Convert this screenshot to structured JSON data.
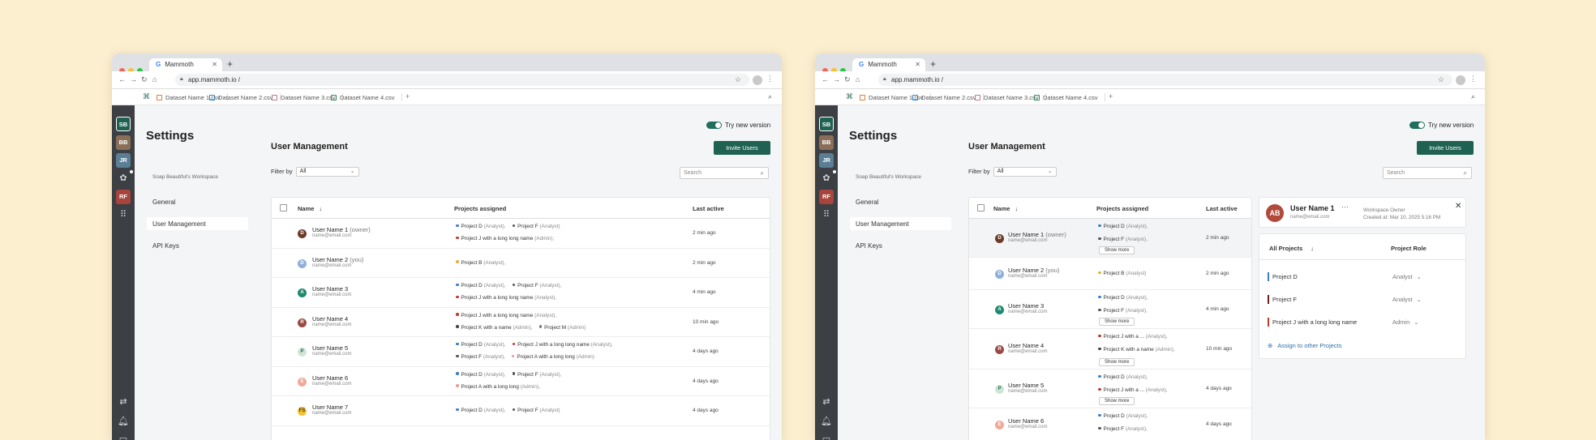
{
  "browser": {
    "tab_title": "Mammoth",
    "url": "app.mammoth.io /"
  },
  "file_tabs": [
    "Dataset Name 1.csv",
    "Dataset Name 2.csv",
    "Dataset Name 3.csv",
    "Dataset Name 4.csv"
  ],
  "file_tab_colors": [
    "#e07b39",
    "#2f80c8",
    "#c0787e",
    "#2e8b57"
  ],
  "rail_avatars": [
    {
      "initials": "SB",
      "color": "#1f6252"
    },
    {
      "initials": "BB",
      "color": "#8a6f58"
    },
    {
      "initials": "JR",
      "color": "#5a7f95"
    },
    {
      "initials": "RF",
      "color": "#a8443c"
    }
  ],
  "settings": {
    "title": "Settings",
    "workspace": "Soap Beautiful's Workspace",
    "nav": [
      "General",
      "User Management",
      "API Keys"
    ],
    "active_nav": "User Management"
  },
  "toggle_label": "Try new version",
  "user_management": {
    "title": "User Management",
    "invite_label": "Invite Users",
    "filter_label": "Filter by",
    "filter_value": "All",
    "search_placeholder": "Search",
    "columns": {
      "name": "Name",
      "projects": "Projects assigned",
      "last": "Last active"
    }
  },
  "users_full": [
    {
      "initial": "D",
      "color": "#6b3b2a",
      "name": "User Name 1",
      "suffix": "(owner)",
      "email": "name@email.com",
      "last": "2 min ago",
      "lines": [
        [
          {
            "p": "Project D",
            "r": "(Analyst),",
            "c": "#3d7cc9"
          },
          {
            "p": "Project F",
            "r": "(Analyst)",
            "c": "#555"
          }
        ],
        [
          {
            "p": "Project J with a long long name",
            "r": "(Admin),",
            "c": "#c0392b"
          }
        ]
      ]
    },
    {
      "initial": "D",
      "color": "#8fb0d8",
      "name": "User Name 2",
      "suffix": "(you)",
      "email": "name@email.com",
      "last": "2 min ago",
      "lines": [
        [
          {
            "p": "Project B",
            "r": "(Analyst),",
            "c": "#e3b431"
          }
        ]
      ]
    },
    {
      "initial": "A",
      "color": "#1e8a6e",
      "name": "User Name 3",
      "suffix": "",
      "email": "name@email.com",
      "last": "4 min ago",
      "lines": [
        [
          {
            "p": "Project D",
            "r": "(Analyst),",
            "c": "#3d7cc9"
          },
          {
            "p": "Project F",
            "r": "(Analyst),",
            "c": "#555"
          }
        ],
        [
          {
            "p": "Project J with a long long name",
            "r": "(Analyst),",
            "c": "#c0392b"
          }
        ]
      ]
    },
    {
      "initial": "R",
      "color": "#9a4a44",
      "name": "User Name 4",
      "suffix": "",
      "email": "name@email.com",
      "last": "10 min ago",
      "lines": [
        [
          {
            "p": "Project J with a long long name",
            "r": "(Analyst),",
            "c": "#c0392b"
          }
        ],
        [
          {
            "p": "Project K with a name",
            "r": "(Admin),",
            "c": "#444"
          },
          {
            "p": "Project M",
            "r": "(Admin)",
            "c": "#777"
          }
        ]
      ]
    },
    {
      "initial": "P",
      "color": "#cfe6d6",
      "name": "User Name 5",
      "suffix": "",
      "email": "name@email.com",
      "last": "4 days ago",
      "lines": [
        [
          {
            "p": "Project D",
            "r": "(Analyst),",
            "c": "#3d7cc9"
          },
          {
            "p": "Project J with a long long name",
            "r": "(Analyst),",
            "c": "#c0392b"
          }
        ],
        [
          {
            "p": "Project F",
            "r": "(Analyst),",
            "c": "#555"
          },
          {
            "p": "Project A with a long long",
            "r": "(Admin)",
            "c": "#e89a9a"
          }
        ]
      ]
    },
    {
      "initial": "E",
      "color": "#f0a898",
      "name": "User Name 6",
      "suffix": "",
      "email": "name@email.com",
      "last": "4 days ago",
      "lines": [
        [
          {
            "p": "Project D",
            "r": "(Analyst),",
            "c": "#3d7cc9"
          },
          {
            "p": "Project F",
            "r": "(Analyst),",
            "c": "#555"
          }
        ],
        [
          {
            "p": "Project A with a long long",
            "r": "(Admin),",
            "c": "#e89a9a"
          }
        ]
      ]
    },
    {
      "initial": "FS",
      "color": "#f2c230",
      "name": "User Name 7",
      "suffix": "",
      "email": "name@email.com",
      "last": "4 days ago",
      "lines": [
        [
          {
            "p": "Project D",
            "r": "(Analyst),",
            "c": "#3d7cc9"
          },
          {
            "p": "Project F",
            "r": "(Analyst)",
            "c": "#555"
          }
        ]
      ]
    }
  ],
  "users_compact": [
    {
      "initial": "D",
      "color": "#6b3b2a",
      "name": "User Name 1",
      "suffix": "(owner)",
      "email": "name@email.com",
      "last": "2 min ago",
      "lines": [
        {
          "p": "Project D",
          "r": "(Analyst),",
          "c": "#3d7cc9"
        },
        {
          "p": "Project F",
          "r": "(Analyst),",
          "c": "#555"
        }
      ],
      "more": true
    },
    {
      "initial": "D",
      "color": "#8fb0d8",
      "name": "User Name 2",
      "suffix": "(you)",
      "email": "name@email.com",
      "last": "2 min ago",
      "lines": [
        {
          "p": "Project B",
          "r": "(Analyst)",
          "c": "#e3b431"
        }
      ],
      "more": false
    },
    {
      "initial": "A",
      "color": "#1e8a6e",
      "name": "User Name 3",
      "suffix": "",
      "email": "name@email.com",
      "last": "4 min ago",
      "lines": [
        {
          "p": "Project D",
          "r": "(Analyst),",
          "c": "#3d7cc9"
        },
        {
          "p": "Project F",
          "r": "(Analyst),",
          "c": "#555"
        }
      ],
      "more": true
    },
    {
      "initial": "R",
      "color": "#9a4a44",
      "name": "User Name 4",
      "suffix": "",
      "email": "name@email.com",
      "last": "10 min ago",
      "lines": [
        {
          "p": "Project J with a ...",
          "r": "(Analyst),",
          "c": "#c0392b"
        },
        {
          "p": "Project K with a name",
          "r": "(Admin),",
          "c": "#444"
        }
      ],
      "more": true
    },
    {
      "initial": "P",
      "color": "#cfe6d6",
      "name": "User Name 5",
      "suffix": "",
      "email": "name@email.com",
      "last": "4 days ago",
      "lines": [
        {
          "p": "Project D",
          "r": "(Analyst),",
          "c": "#3d7cc9"
        },
        {
          "p": "Project J with a ...",
          "r": "(Analyst),",
          "c": "#c0392b"
        }
      ],
      "more": true
    },
    {
      "initial": "E",
      "color": "#f0a898",
      "name": "User Name 6",
      "suffix": "",
      "email": "name@email.com",
      "last": "4 days ago",
      "lines": [
        {
          "p": "Project D",
          "r": "(Analyst),",
          "c": "#3d7cc9"
        },
        {
          "p": "Project F",
          "r": "(Analyst),",
          "c": "#555"
        }
      ],
      "more": false
    }
  ],
  "show_more_label": "Show more",
  "detail": {
    "initials": "AB",
    "name": "User Name 1",
    "email": "name@email.com",
    "role": "Workspace Owner",
    "created": "Created at: Mar 10, 2025 5:16 PM",
    "col_projects": "All Projects",
    "col_role": "Project Role",
    "projects": [
      {
        "name": "Project D",
        "role": "Analyst",
        "color": "#3d7cc9"
      },
      {
        "name": "Project F",
        "role": "Analyst",
        "color": "#6b1e1e"
      },
      {
        "name": "Project J with a long long name",
        "role": "Admin",
        "color": "#c0392b"
      }
    ],
    "assign_label": "Assign to other Projects"
  }
}
